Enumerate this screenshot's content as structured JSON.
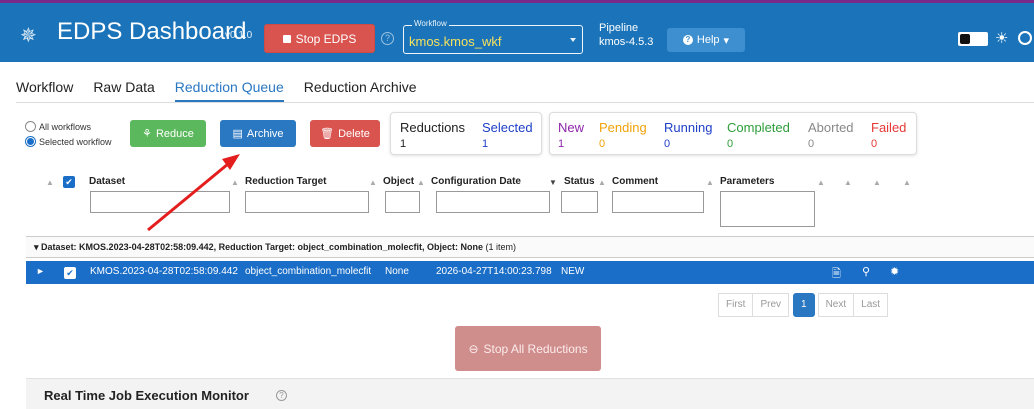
{
  "header": {
    "title": "EDPS Dashboard",
    "version": "v0.1.0",
    "stop_label": "Stop EDPS",
    "workflow_label": "Workflow",
    "workflow_value": "kmos.kmos_wkf",
    "pipeline_label": "Pipeline",
    "pipeline_value": "kmos-4.5.3",
    "help_label": "Help",
    "colors": {
      "bar": "#1b74b9",
      "workflow_text": "#f6e15d",
      "stop": "#d9534f"
    }
  },
  "tabs": [
    "Workflow",
    "Raw Data",
    "Reduction Queue",
    "Reduction Archive"
  ],
  "active_tab": "Reduction Queue",
  "controls": {
    "radio_all": "All workflows",
    "radio_selected": "Selected workflow",
    "reduce_label": "Reduce",
    "archive_label": "Archive",
    "delete_label": "Delete"
  },
  "stats": {
    "reductions": {
      "label": "Reductions",
      "value": "1"
    },
    "selected": {
      "label": "Selected",
      "value": "1"
    },
    "new": {
      "label": "New",
      "value": "1",
      "color": "#8e24aa"
    },
    "pending": {
      "label": "Pending",
      "value": "0",
      "color": "#f0a30a"
    },
    "running": {
      "label": "Running",
      "value": "0",
      "color": "#1e3fc7"
    },
    "completed": {
      "label": "Completed",
      "value": "0",
      "color": "#2e9d3a"
    },
    "aborted": {
      "label": "Aborted",
      "value": "0",
      "color": "#888888"
    },
    "failed": {
      "label": "Failed",
      "value": "0",
      "color": "#e53935"
    }
  },
  "table": {
    "columns": [
      "Dataset",
      "Reduction Target",
      "Object",
      "Configuration Date",
      "Status",
      "Comment",
      "Parameters"
    ],
    "group_label": "Dataset: KMOS.2023-04-28T02:58:09.442, Reduction Target: object_combination_molecfit, Object: None",
    "group_count": "(1 item)",
    "row": {
      "dataset": "KMOS.2023-04-28T02:58:09.442",
      "target": "object_combination_molecfit",
      "object": "None",
      "config_date": "2026-04-27T14:00:23.798",
      "status": "NEW"
    }
  },
  "pager": {
    "first": "First",
    "prev": "Prev",
    "page": "1",
    "next": "Next",
    "last": "Last"
  },
  "stop_all_label": "Stop All Reductions",
  "monitor_title": "Real Time Job Execution Monitor"
}
